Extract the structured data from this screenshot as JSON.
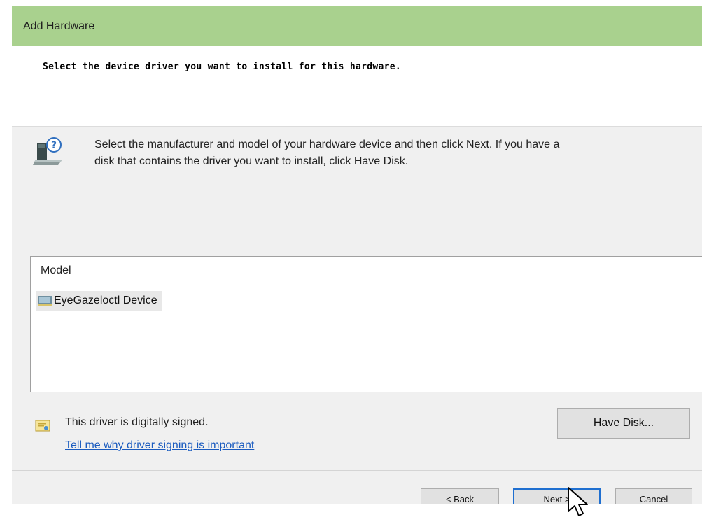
{
  "window": {
    "title": "Add Hardware"
  },
  "header": {
    "heading": "Select the device driver you want to install for this hardware."
  },
  "description": {
    "line1": "Select the manufacturer and model of your hardware device and then click Next. If you have a",
    "line2": "disk that contains the driver you want to install, click Have Disk."
  },
  "model_list": {
    "column_header": "Model",
    "items": [
      {
        "label": "EyeGazeloctl Device",
        "selected": true
      }
    ]
  },
  "signing": {
    "status_text": "This driver is digitally signed.",
    "link_text": "Tell me why driver signing is important"
  },
  "buttons": {
    "have_disk": "Have Disk...",
    "back": "< Back",
    "next": "Next >",
    "cancel": "Cancel"
  },
  "colors": {
    "titlebar": "#a9d18e",
    "link": "#1a5bbf",
    "focus_border": "#1f6fd0"
  },
  "icons": [
    "hardware-question-icon",
    "device-icon",
    "certificate-icon",
    "mouse-cursor-icon"
  ]
}
